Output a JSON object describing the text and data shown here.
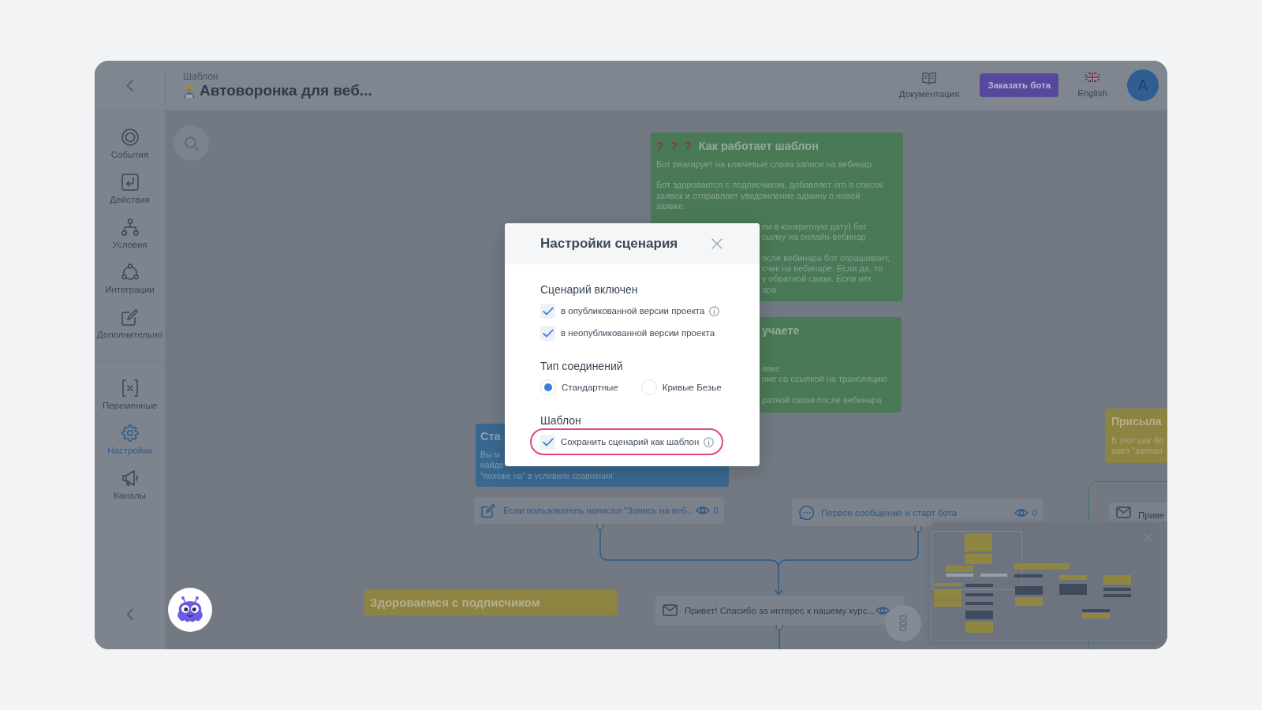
{
  "header": {
    "caption": "Шаблон",
    "title": "Автоворонка для веб...",
    "docs_label": "Документация",
    "order_button": "Заказать бота",
    "language": "English",
    "avatar": "A"
  },
  "sidebar": {
    "groups": [
      {
        "items": [
          {
            "label": "События",
            "selected": false
          },
          {
            "label": "Действия",
            "selected": false
          },
          {
            "label": "Условия",
            "selected": false
          },
          {
            "label": "Интеграции",
            "selected": false
          },
          {
            "label": "Дополнительно",
            "selected": false
          }
        ]
      },
      {
        "items": [
          {
            "label": "Переменные",
            "selected": false
          },
          {
            "label": "Настройки",
            "selected": true
          },
          {
            "label": "Каналы",
            "selected": false
          }
        ]
      }
    ]
  },
  "canvas": {
    "notes": [
      {
        "color": "#4a7956",
        "marks": "? ? ?",
        "title": {
          "kind": "full",
          "text": "Как работает шаблон"
        },
        "paragraphs": [
          {
            "lines": [
              {
                "kind": "full",
                "text": "Бот реагирует на ключевые слова записи на вебинар."
              }
            ]
          },
          {
            "lines": [
              {
                "kind": "full",
                "text": "Бот здоровается с подписчиком, добавляет его в список заявок и отправляет уведомление админу о новой заявке."
              }
            ]
          },
          {
            "lines": [
              {
                "kind": "tail",
                "text": "ли в конкретную дату) бот"
              },
              {
                "kind": "tail",
                "text": "сылку на онлайн-вебинар"
              }
            ]
          },
          {
            "lines": [
              {
                "kind": "tail",
                "text": "осле вебинара бот спрашивает,"
              },
              {
                "kind": "tail",
                "text": "счик на вебинаре. Если да, то"
              },
              {
                "kind": "tail",
                "text": "у обратной связи. Если нет,"
              },
              {
                "kind": "tail",
                "text": "ара"
              }
            ]
          }
        ]
      },
      {
        "color": "#4a7956",
        "title": {
          "kind": "tail",
          "text": "учаете"
        },
        "paragraphs": [
          {
            "lines": [
              {
                "kind": "tail",
                "text": "явке"
              },
              {
                "kind": "tail",
                "text": "ние со ссылкой на трансляцию"
              }
            ]
          },
          {
            "lines": [
              {
                "kind": "tail",
                "text": "ратной связи после вебинара"
              }
            ]
          }
        ]
      },
      {
        "color": "#39688f",
        "title": {
          "kind": "head",
          "text": "Ста"
        },
        "paragraphs": [
          {
            "lines": [
              {
                "kind": "head",
                "text": "Вы м"
              },
              {
                "kind": "head",
                "text": "найде"
              },
              {
                "kind": "full",
                "text": "\"похоже на\" в условиях сравнения"
              }
            ]
          }
        ]
      },
      {
        "color": "#8d8441",
        "title": {
          "kind": "full",
          "text": "Здороваемся с подписчиком"
        }
      },
      {
        "color": "#8d8441",
        "title": {
          "kind": "head",
          "text": "Присыла"
        },
        "paragraphs": [
          {
            "lines": [
              {
                "kind": "head",
                "text": "В этот шаг бо"
              },
              {
                "kind": "head",
                "text": "шага \"заплан"
              }
            ]
          }
        ]
      }
    ],
    "nodes": [
      {
        "kind": "condition",
        "text": "Если пользователь написал \"Запись на веб...",
        "eye": true,
        "views": "0"
      },
      {
        "kind": "start",
        "text": "Первое сообщение и старт бота",
        "eye": true,
        "views": "0"
      },
      {
        "kind": "message",
        "text": "Привет! Спасибо за интерес к нашему курс...",
        "eye": true
      },
      {
        "kind": "message",
        "text": "Приве"
      }
    ]
  },
  "dialog": {
    "title": "Настройки сценария",
    "sections": [
      {
        "heading": "Сценарий включен",
        "options": [
          {
            "kind": "checkbox",
            "label": "в опубликованной версии проекта",
            "checked": true,
            "info": true,
            "highlighted": false
          },
          {
            "kind": "checkbox",
            "label": "в неопубликованной версии проекта",
            "checked": true,
            "info": false,
            "highlighted": false
          }
        ]
      },
      {
        "heading": "Тип соединений",
        "options": [
          {
            "kind": "radio",
            "label": "Стандартные",
            "selected": true,
            "info": false,
            "highlighted": false
          },
          {
            "kind": "radio",
            "label": "Кривые Безье",
            "selected": false,
            "info": false,
            "highlighted": false
          }
        ]
      },
      {
        "heading": "Шаблон",
        "options": [
          {
            "kind": "checkbox",
            "label": "Сохранить сценарий как шаблон",
            "checked": true,
            "info": true,
            "highlighted": true
          }
        ]
      }
    ]
  }
}
